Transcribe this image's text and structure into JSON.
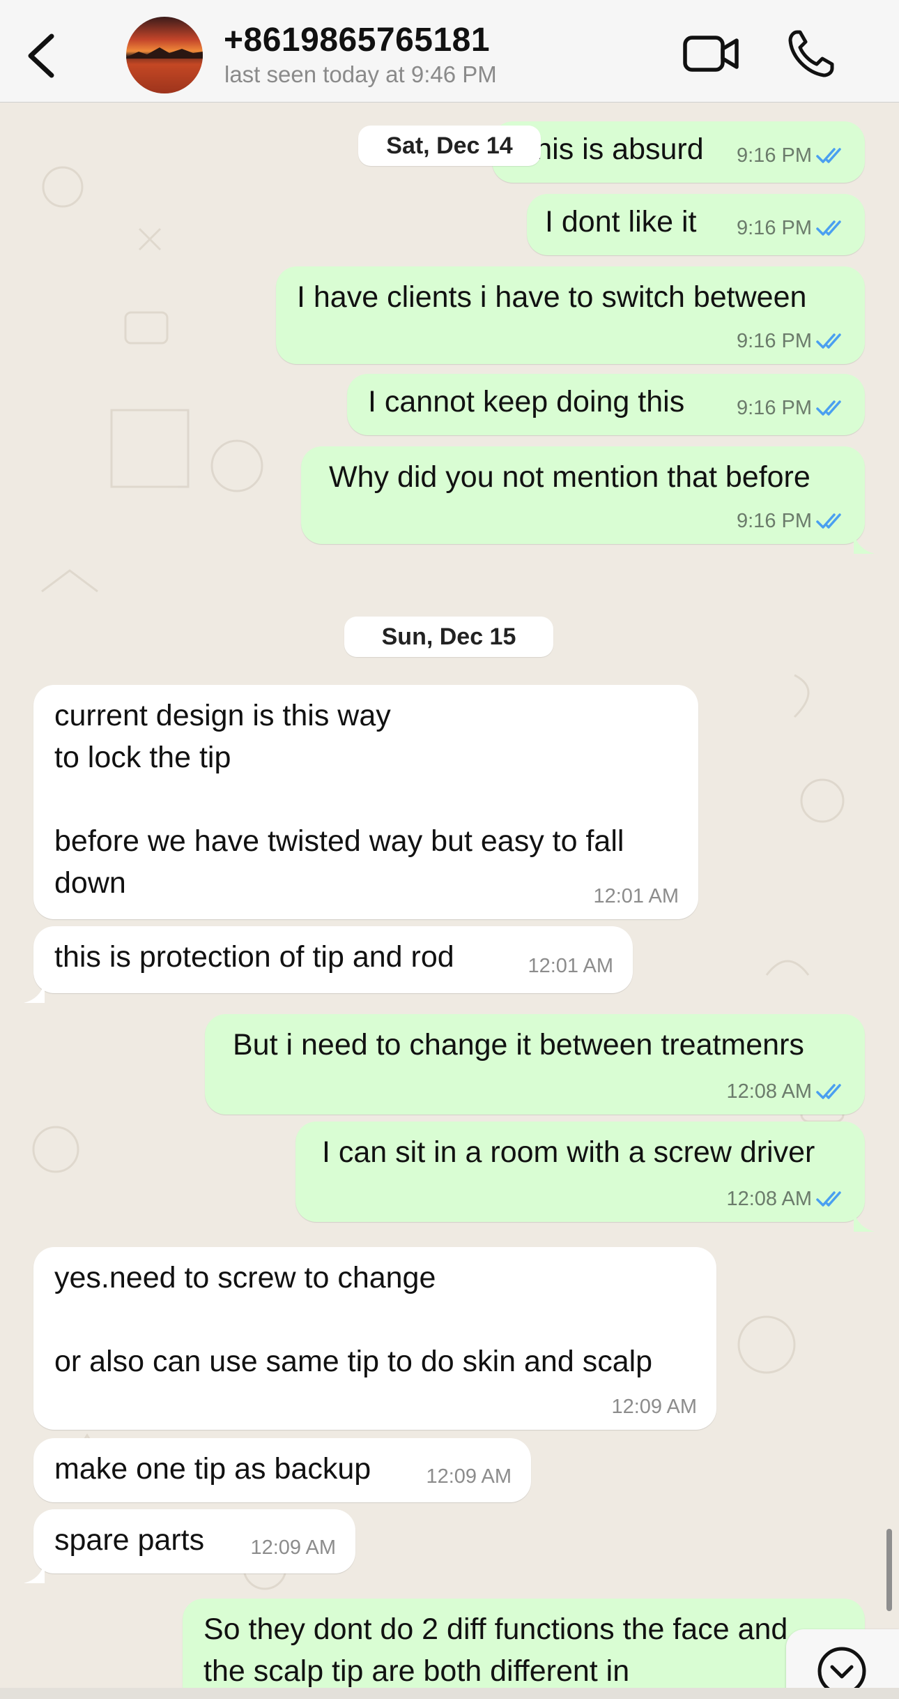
{
  "header": {
    "contact_name": "+8619865765181",
    "status": "last seen today at 9:46 PM",
    "icons": {
      "back": "chevron-left-icon",
      "video": "video-camera-icon",
      "call": "phone-icon"
    }
  },
  "colors": {
    "outgoing_bubble": "#d9fdd3",
    "incoming_bubble": "#ffffff",
    "read_ticks": "#4a9ff0",
    "chat_background": "#efeae2"
  },
  "date_separators": [
    "Sat, Dec 14",
    "Sun, Dec 15"
  ],
  "messages": [
    {
      "dir": "out",
      "text": "This is absurd",
      "time": "9:16 PM",
      "read": true
    },
    {
      "dir": "out",
      "text": "I dont like it",
      "time": "9:16 PM",
      "read": true
    },
    {
      "dir": "out",
      "text": "I have clients i have to switch between",
      "time": "9:16 PM",
      "read": true
    },
    {
      "dir": "out",
      "text": "I cannot keep doing this",
      "time": "9:16 PM",
      "read": true
    },
    {
      "dir": "out",
      "text": "Why did you not mention that before",
      "time": "9:16 PM",
      "read": true
    },
    {
      "dir": "in",
      "text": "current design is this way\nto lock the tip\n\nbefore we have twisted way but easy to fall\ndown",
      "time": "12:01 AM"
    },
    {
      "dir": "in",
      "text": "this is protection of tip and rod",
      "time": "12:01 AM"
    },
    {
      "dir": "out",
      "text": "But i need to change it between treatmenrs",
      "time": "12:08 AM",
      "read": true
    },
    {
      "dir": "out",
      "text": "I can sit in a room with a screw driver",
      "time": "12:08 AM",
      "read": true
    },
    {
      "dir": "in",
      "text": "yes.need to screw to change\n\nor also can use same tip to do skin and scalp",
      "time": "12:09 AM"
    },
    {
      "dir": "in",
      "text": "make one tip as backup",
      "time": "12:09 AM"
    },
    {
      "dir": "in",
      "text": "spare parts",
      "time": "12:09 AM"
    },
    {
      "dir": "out",
      "text": "So they dont do 2 diff functions the face and\nthe scalp tip are both different in",
      "time": "",
      "read": false
    }
  ],
  "scroll_button_icon": "chevron-down-circle-icon"
}
